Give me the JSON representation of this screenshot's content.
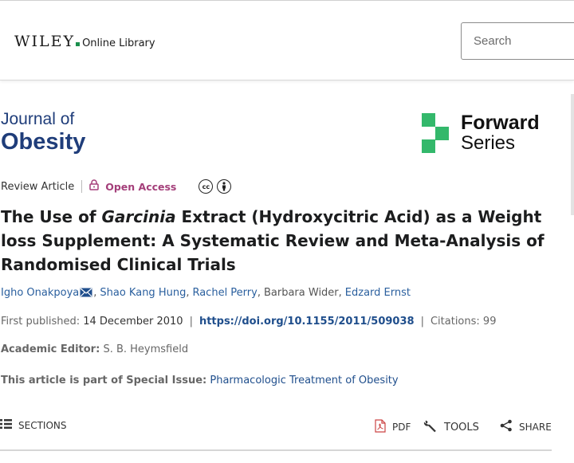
{
  "header": {
    "logo_brand": "WILEY",
    "logo_sub": "Online Library",
    "search_placeholder": "Search"
  },
  "journal": {
    "line1": "Journal of",
    "line2": "Obesity"
  },
  "forward": {
    "line1": "Forward",
    "line2": "Series"
  },
  "meta": {
    "article_type": "Review Article",
    "access": "Open Access"
  },
  "article": {
    "title_part1": "The Use of ",
    "title_italic": "Garcinia",
    "title_part2": " Extract (Hydroxycitric Acid) as a Weight loss Supplement: A Systematic Review and Meta-Analysis of Randomised Clinical Trials"
  },
  "authors": [
    "Igho Onakpoya",
    "Shao Kang Hung",
    "Rachel Perry",
    "Barbara Wider",
    "Edzard Ernst"
  ],
  "publication": {
    "first_published_label": "First published:",
    "first_published_date": "14 December 2010",
    "doi": "https://doi.org/10.1155/2011/509038",
    "citations_label": "Citations:",
    "citations_count": "99"
  },
  "editor": {
    "label": "Academic Editor:",
    "name": "S. B. Heymsfield"
  },
  "special_issue": {
    "label": "This article is part of Special Issue:",
    "title": "Pharmacologic Treatment of Obesity"
  },
  "toolbar": {
    "sections": "SECTIONS",
    "pdf": "PDF",
    "tools": "TOOLS",
    "share": "SHARE"
  },
  "colors": {
    "journal_blue": "#1f3d7a",
    "link_blue": "#2a5f9e",
    "open_access": "#a43f7a",
    "forward_green": "#33b86b"
  }
}
